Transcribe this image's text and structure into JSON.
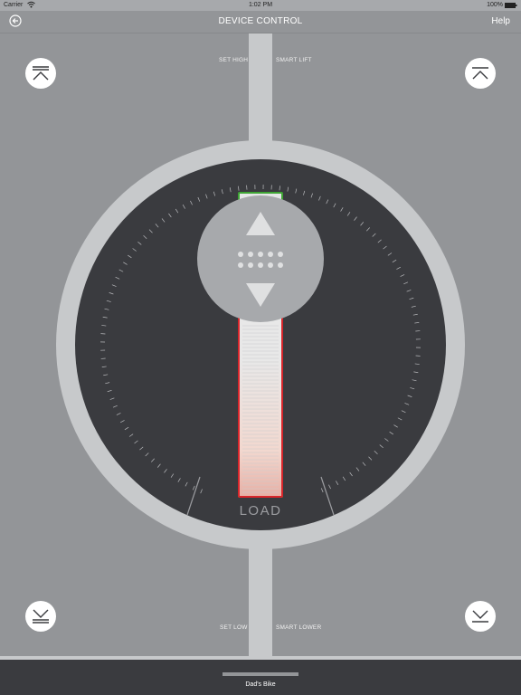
{
  "status_bar": {
    "carrier": "Carrier",
    "time": "1:02 PM",
    "battery": "100%"
  },
  "nav": {
    "title": "DEVICE CONTROL",
    "help_label": "Help",
    "back_icon": "back-arrow-icon"
  },
  "labels": {
    "set_high": "SET HIGH",
    "smart_lift": "SMART LIFT",
    "set_low": "SET LOW",
    "smart_lower": "SMART LOWER",
    "load": "LOAD"
  },
  "controls": {
    "top_left_icon": "raise-to-top-icon",
    "top_right_icon": "smart-lift-icon",
    "bottom_left_icon": "lower-to-bottom-icon",
    "bottom_right_icon": "smart-lower-icon",
    "joystick_up_icon": "arrow-up-icon",
    "joystick_down_icon": "arrow-down-icon"
  },
  "colors": {
    "accent_top": "#3fa535",
    "accent_bottom": "#d8262b",
    "dial": "#3a3b3f",
    "ring": "#c7c9cb"
  },
  "footer": {
    "device_name": "Dad's Bike"
  }
}
